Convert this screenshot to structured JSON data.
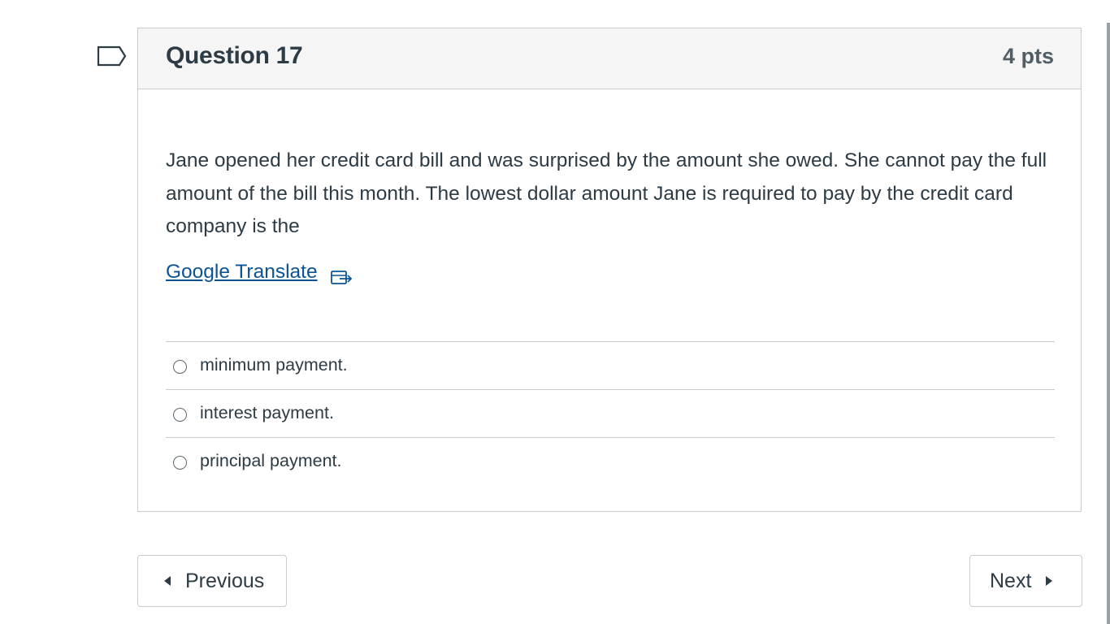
{
  "question": {
    "title": "Question 17",
    "points": "4 pts",
    "text": "Jane opened her credit card bill and was surprised by the amount she owed.  She cannot pay the full amount of the bill this month.  The lowest dollar amount Jane is required to pay by the credit card company is the",
    "translate_link": "Google Translate",
    "translate_icon": "external-link-icon",
    "flag_icon": "flag-question-icon",
    "answers": [
      {
        "label": "minimum payment."
      },
      {
        "label": "interest payment."
      },
      {
        "label": "principal payment."
      }
    ]
  },
  "nav": {
    "previous_label": "Previous",
    "next_label": "Next"
  },
  "colors": {
    "text": "#2d3b45",
    "link": "#0b5394",
    "header_bg": "#f5f5f5",
    "border": "#c7cdd1"
  }
}
